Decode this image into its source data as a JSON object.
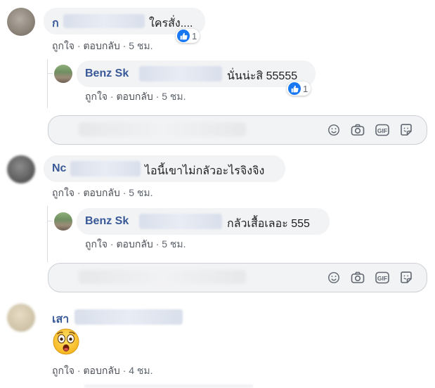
{
  "comments": [
    {
      "name": "ก",
      "text": "ใครสั่ง....",
      "like_action": "ถูกใจ",
      "reply_action": "ตอบกลับ",
      "time": "5 ชม.",
      "reaction_count": "1",
      "reply": {
        "name": "Benz Sk",
        "text": "นั่นน่ะสิ 55555",
        "like_action": "ถูกใจ",
        "reply_action": "ตอบกลับ",
        "time": "5 ชม.",
        "reaction_count": "1"
      }
    },
    {
      "name": "Nc",
      "text": "ไอนี้เขาไม่กลัวอะไรจิงจิง",
      "like_action": "ถูกใจ",
      "reply_action": "ตอบกลับ",
      "time": "5 ชม.",
      "reply": {
        "name": "Benz Sk",
        "text": "กลัวเสื้อเลอะ 555",
        "like_action": "ถูกใจ",
        "reply_action": "ตอบกลับ",
        "time": "5 ชม."
      }
    },
    {
      "name": "เสา",
      "emoji": "😲",
      "like_action": "ถูกใจ",
      "reply_action": "ตอบกลับ",
      "time": "4 ชม."
    }
  ],
  "composer": {
    "gif_label": "GIF",
    "icons": [
      "emoji-icon",
      "camera-icon",
      "gif-icon",
      "sticker-icon"
    ]
  },
  "separator": "·",
  "colors": {
    "name_blue": "#385898",
    "like_blue": "#1877f2",
    "bubble_grey": "#f2f3f5",
    "meta_grey": "#606770"
  }
}
